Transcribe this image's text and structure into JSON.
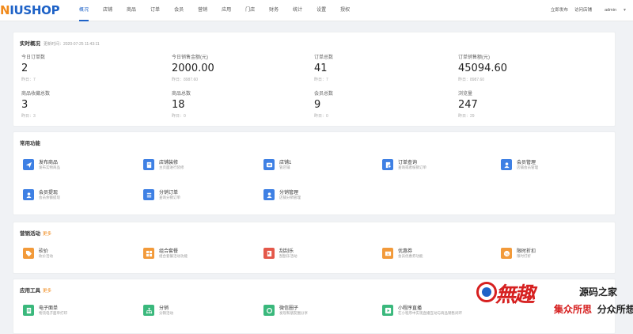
{
  "header": {
    "logo": "NIUSHOP",
    "nav": [
      "概况",
      "店铺",
      "商品",
      "订单",
      "会员",
      "营销",
      "应用",
      "门店",
      "财务",
      "统计",
      "设置",
      "授权"
    ],
    "active_index": 0,
    "right": {
      "publish": "立即发布",
      "visit": "访问店铺",
      "user": "admin"
    }
  },
  "overview": {
    "title": "实时概况",
    "updated": "更新时间：2020-07-25 11:43:11",
    "stats": [
      {
        "label": "今日订单数",
        "value": "2",
        "yesterday": "昨日：7"
      },
      {
        "label": "今日销售金额(元)",
        "value": "2000.00",
        "yesterday": "昨日：8987.60"
      },
      {
        "label": "订单总数",
        "value": "41",
        "yesterday": "昨日：7"
      },
      {
        "label": "订单销售额(元)",
        "value": "45094.60",
        "yesterday": "昨日：8987.60"
      },
      {
        "label": "商品收藏总数",
        "value": "3",
        "yesterday": "昨日：3"
      },
      {
        "label": "商品总数",
        "value": "18",
        "yesterday": "昨日：0"
      },
      {
        "label": "会员总数",
        "value": "9",
        "yesterday": "昨日：0"
      },
      {
        "label": "浏览量",
        "value": "247",
        "yesterday": "昨日：29"
      }
    ]
  },
  "common": {
    "title": "常用功能",
    "items": [
      {
        "title": "发布商品",
        "desc": "发布实物商品",
        "icon": "send-icon",
        "color": "#3e80e4"
      },
      {
        "title": "店铺装修",
        "desc": "主页面进行装修",
        "icon": "file-icon",
        "color": "#3e80e4"
      },
      {
        "title": "店铺1",
        "desc": "管店铺",
        "icon": "store-icon",
        "color": "#3e80e4"
      },
      {
        "title": "订单查询",
        "desc": "查询或者核销订单",
        "icon": "order-icon",
        "color": "#3e80e4"
      },
      {
        "title": "会员管理",
        "desc": "店铺会员管理",
        "icon": "user-icon",
        "color": "#3e80e4"
      },
      {
        "title": "会员提现",
        "desc": "会员余额提现",
        "icon": "user-icon",
        "color": "#3e80e4"
      },
      {
        "title": "分销订单",
        "desc": "查询分销订单",
        "icon": "list-icon",
        "color": "#3e80e4"
      },
      {
        "title": "分销管理",
        "desc": "店铺分销管理",
        "icon": "user-icon",
        "color": "#3e80e4"
      }
    ]
  },
  "marketing": {
    "title": "营销活动",
    "more": "更多",
    "items": [
      {
        "title": "砍价",
        "desc": "砍价活动",
        "icon": "tag-icon",
        "color": "#f29a3a"
      },
      {
        "title": "组合套餐",
        "desc": "组合套餐活动功能",
        "icon": "grid-icon",
        "color": "#f29a3a"
      },
      {
        "title": "刮刮乐",
        "desc": "刮刮乐活动",
        "icon": "card-icon",
        "color": "#e4584a"
      },
      {
        "title": "优惠券",
        "desc": "会员优惠券功能",
        "icon": "coupon-icon",
        "color": "#f29a3a"
      },
      {
        "title": "限时折扣",
        "desc": "限时打折",
        "icon": "discount-icon",
        "color": "#f29a3a"
      }
    ]
  },
  "tools": {
    "title": "应用工具",
    "more": "更多",
    "items": [
      {
        "title": "电子面单",
        "desc": "物流电子面单打印",
        "icon": "sheet-icon",
        "color": "#3ab87c"
      },
      {
        "title": "分销",
        "desc": "分销活动",
        "icon": "tree-icon",
        "color": "#3ab87c"
      },
      {
        "title": "微信圈子",
        "desc": "发现和朋友圈分享",
        "icon": "circle-icon",
        "color": "#3ab87c"
      },
      {
        "title": "小程序直播",
        "desc": "在小程序中实现直播互动与商品销售闭环",
        "icon": "video-icon",
        "color": "#3ab87c"
      }
    ]
  },
  "watermark": {
    "big": "無趣",
    "line1": "源码之家",
    "line2a": "集众所思",
    "line2b": "分众所想"
  }
}
